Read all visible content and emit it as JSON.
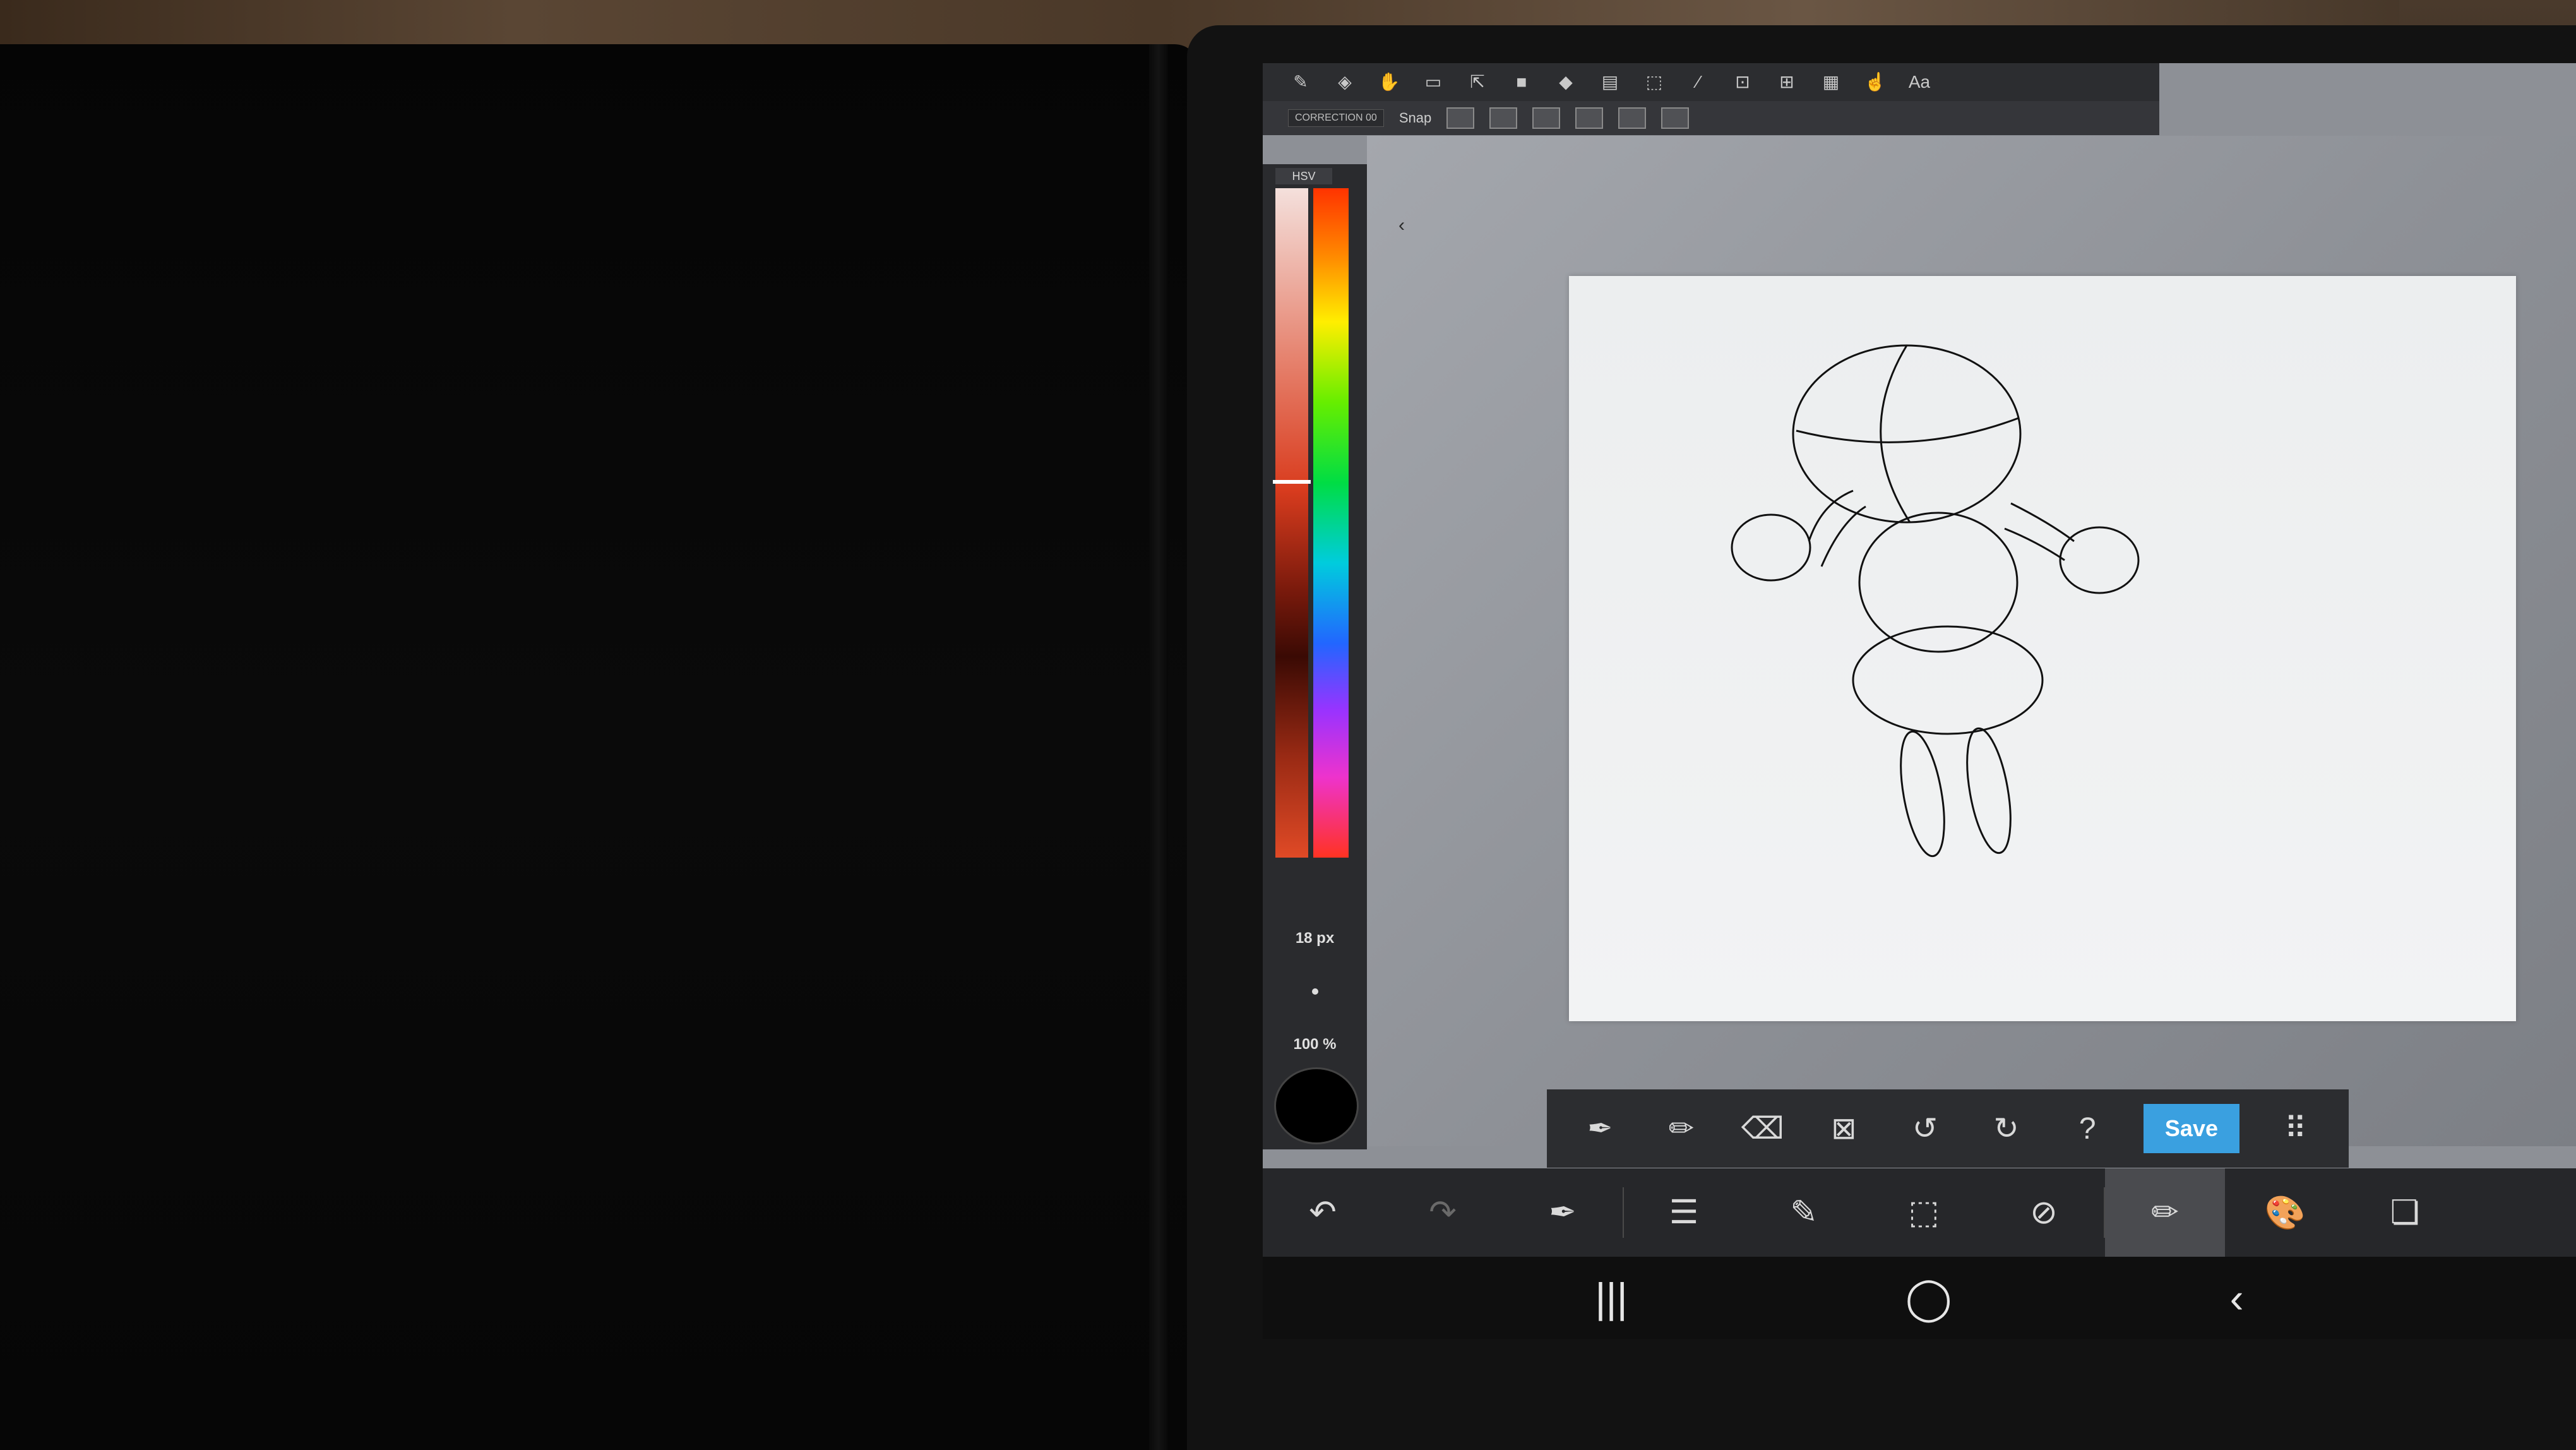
{
  "top_toolbar": {
    "icons": [
      "pen-icon",
      "eraser-icon",
      "hand-icon",
      "layer-icon",
      "select-icon",
      "fill-icon",
      "bucket-icon",
      "gradient-icon",
      "marquee-icon",
      "eyedropper-icon",
      "transform-icon",
      "export-icon",
      "layers-icon",
      "pointer-icon",
      "text-icon"
    ],
    "text_label": "Aa"
  },
  "sub_toolbar": {
    "correction_label": "CORRECTION",
    "correction_value": "00",
    "snap_label": "Snap"
  },
  "color_panel": {
    "mode_tab": "HSV",
    "brush_size": "18 px",
    "opacity": "100 %",
    "current_color": "#000000"
  },
  "quick_toolbar": {
    "icons": [
      "eyedropper-icon",
      "pen-icon",
      "eraser-icon",
      "deselect-icon",
      "undo-icon",
      "redo-icon",
      "help-icon"
    ],
    "save_label": "Save",
    "grid_icon": "grid-icon"
  },
  "main_toolbar": {
    "items": [
      {
        "name": "undo-icon",
        "glyph": "↶"
      },
      {
        "name": "redo-icon",
        "glyph": "↷"
      },
      {
        "name": "eyedropper-icon",
        "glyph": "✒"
      },
      {
        "name": "menu-icon",
        "glyph": "☰"
      },
      {
        "name": "edit-icon",
        "glyph": "✎"
      },
      {
        "name": "selection-icon",
        "glyph": "⬚"
      },
      {
        "name": "rotate-canvas-icon",
        "glyph": "⊘"
      },
      {
        "name": "brush-icon",
        "glyph": "✏"
      },
      {
        "name": "palette-icon",
        "glyph": "🎨"
      },
      {
        "name": "layers-icon",
        "glyph": "❏"
      }
    ]
  },
  "nav_bar": {
    "recents": "|||",
    "home": "◯",
    "back": "‹"
  }
}
